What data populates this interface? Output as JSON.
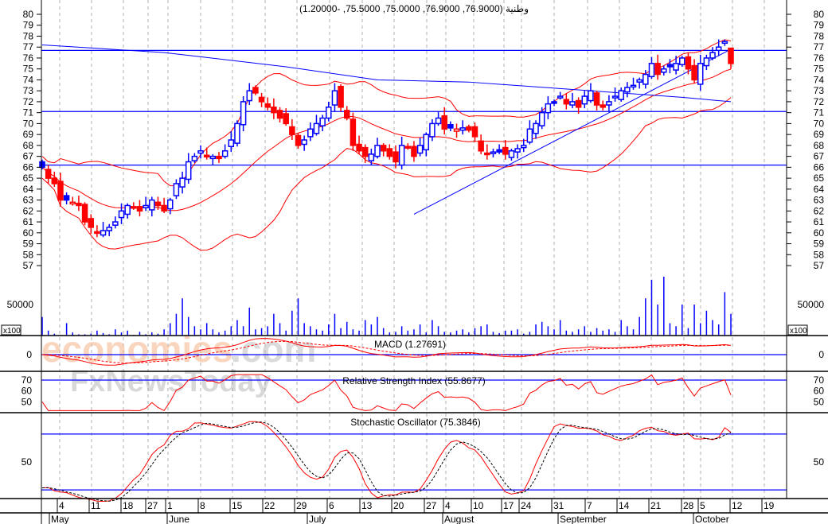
{
  "chart_data": {
    "type": "candlestick",
    "title": "وطنية (76.9000, 76.9000, 75.0000, 75.5000, -1.20000)",
    "price_axis": {
      "min": 57,
      "max": 80,
      "ticks": [
        80,
        79,
        78,
        77,
        76,
        75,
        74,
        73,
        72,
        71,
        70,
        69,
        68,
        67,
        66,
        65,
        64,
        63,
        62,
        61,
        60,
        59,
        58,
        57
      ]
    },
    "horizontal_lines": [
      76.7,
      71.1,
      66.2
    ],
    "closes": [
      66,
      65,
      64.5,
      63,
      63,
      62.8,
      62.5,
      61,
      60.5,
      60,
      60.2,
      60.5,
      61,
      62,
      62.5,
      62.3,
      62,
      62.5,
      63,
      62.5,
      62,
      63,
      64.5,
      65,
      66.5,
      67,
      67.5,
      67,
      67,
      66.8,
      67.5,
      68.5,
      70,
      72,
      73,
      72.8,
      72,
      71.5,
      71,
      70.5,
      70,
      69,
      68,
      68.5,
      69.5,
      70,
      70.5,
      71.5,
      73,
      71.5,
      70.5,
      68,
      67.5,
      67,
      67.2,
      68,
      67.5,
      67,
      66.5,
      68,
      67.8,
      67,
      68,
      69,
      70,
      70.5,
      69.5,
      69.6,
      69.5,
      69.6,
      69.4,
      68.8,
      67.5,
      67.3,
      67.4,
      67.4,
      67.2,
      67.5,
      67.7,
      68,
      69.5,
      70,
      71,
      71.8,
      72,
      72.5,
      71.8,
      72,
      71.5,
      72.5,
      73,
      71.7,
      71.5,
      72,
      72.5,
      73,
      73.3,
      73.5,
      74,
      74.5,
      75.5,
      74.5,
      75,
      75.2,
      75.5,
      76,
      75,
      74,
      75.5,
      76,
      76.5,
      77,
      77.5,
      75.5
    ],
    "last_candle": {
      "open": 76.9,
      "high": 76.9,
      "low": 75.0,
      "close": 75.5,
      "change": -1.2
    },
    "ma_long": [
      [
        0,
        77.2
      ],
      [
        20,
        76.5
      ],
      [
        40,
        75.2
      ],
      [
        55,
        74
      ],
      [
        70,
        73.8
      ],
      [
        90,
        73
      ],
      [
        105,
        72.4
      ],
      [
        113,
        72
      ]
    ],
    "trendline": [
      [
        61,
        61.7
      ],
      [
        113,
        76.8
      ]
    ],
    "volume": {
      "unit_label": "x100",
      "tick": 50000,
      "values": [
        30000,
        8000,
        3000,
        1000,
        20000,
        5000,
        2000,
        2000,
        3000,
        8000,
        4000,
        2000,
        10000,
        5000,
        8000,
        1000,
        6000,
        2000,
        5000,
        3000,
        10000,
        20000,
        35000,
        60000,
        30000,
        15000,
        10000,
        20000,
        10000,
        5000,
        8000,
        15000,
        25000,
        15000,
        45000,
        10000,
        12000,
        15000,
        35000,
        20000,
        8000,
        40000,
        60000,
        20000,
        15000,
        10000,
        8000,
        18000,
        35000,
        12000,
        22000,
        10000,
        8000,
        25000,
        18000,
        30000,
        12000,
        5000,
        6000,
        15000,
        8000,
        10000,
        18000,
        5000,
        25000,
        15000,
        6000,
        5000,
        8000,
        10000,
        5000,
        12000,
        15000,
        18000,
        6000,
        4000,
        8000,
        8000,
        10000,
        3000,
        6000,
        18000,
        22000,
        15000,
        10000,
        25000,
        8000,
        6000,
        10000,
        15000,
        6000,
        12000,
        8000,
        10000,
        6000,
        25000,
        15000,
        10000,
        30000,
        60000,
        90000,
        50000,
        95000,
        20000,
        15000,
        50000,
        12000,
        50000,
        20000,
        40000,
        25000,
        18000,
        70000,
        35000
      ]
    },
    "macd": {
      "label": "MACD (1.27691)",
      "ticks": [
        0
      ]
    },
    "rsi": {
      "label": "Relative Strength Index (55.8677)",
      "ticks": [
        70,
        60,
        50
      ],
      "level": 70
    },
    "stochastic": {
      "label": "Stochastic Oscillator (75.3846)",
      "ticks": [
        50
      ],
      "levels": [
        80,
        20
      ]
    },
    "x_axis": {
      "day_ticks": [
        "4",
        "11",
        "18",
        "27",
        "1",
        "8",
        "15",
        "22",
        "29",
        "6",
        "13",
        "20",
        "27",
        "4",
        "10",
        "17",
        "24",
        "31",
        "7",
        "14",
        "21",
        "28",
        "5",
        "12",
        "19"
      ],
      "months": [
        "May",
        "June",
        "July",
        "August",
        "September",
        "October"
      ]
    },
    "colors": {
      "up": "#0000ff",
      "down": "#ff0000",
      "bands": "#ff0000",
      "ma": "#0000ff",
      "grid": "#b0b0b0"
    }
  },
  "watermark": {
    "line1a": "economies",
    "line1b": ".com",
    "line2": "FxNewsToday"
  }
}
